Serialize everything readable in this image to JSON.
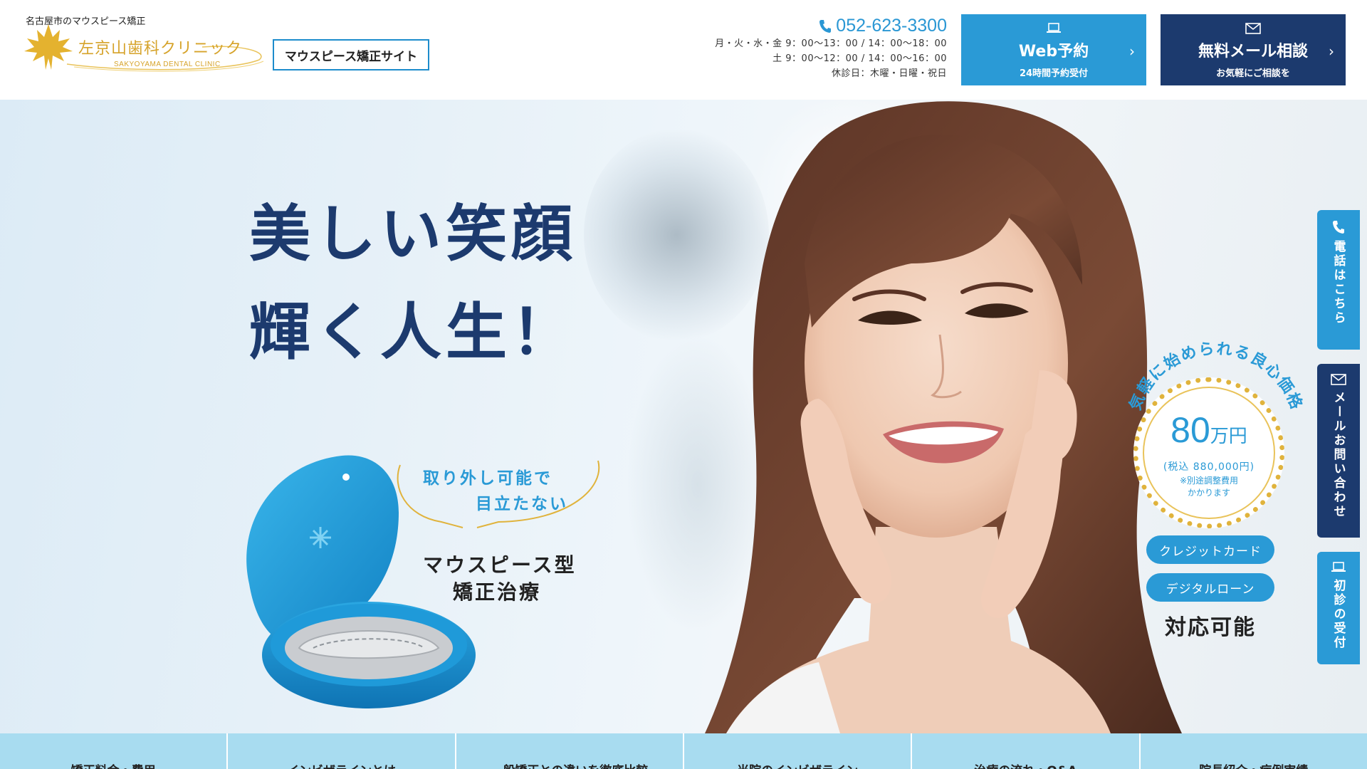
{
  "header": {
    "tagline": "名古屋市のマウスピース矯正",
    "logo_name": "左京山歯科クリニック",
    "logo_sub": "SAKYOYAMA DENTAL CLINIC",
    "site_badge": "マウスピース矯正サイト",
    "phone": "052-623-3300",
    "hours_1": "月・火・水・金 9：00〜13：00 / 14：00〜18：00",
    "hours_2": "土 9：00〜12：00 / 14：00〜16：00",
    "hours_3": "休診日：木曜・日曜・祝日",
    "web_btn_main": "Web予約",
    "web_btn_sub": "24時間予約受付",
    "mail_btn_main": "無料メール相談",
    "mail_btn_sub": "お気軽にご相談を",
    "arrow": "›"
  },
  "hero": {
    "headline_1": "美しい笑顔",
    "headline_2": "輝く人生！",
    "bubble_1": "取り外し可能で",
    "bubble_2": "目立たない",
    "treatment_1": "マウスピース型",
    "treatment_2": "矯正治療",
    "arc_text": "気軽に始められる良心価格",
    "price_num": "80",
    "price_unit": "万円",
    "price_tax": "(税込 880,000円)",
    "price_note_1": "※別途調整費用",
    "price_note_2": "かかります",
    "pay_1": "クレジットカード",
    "pay_2": "デジタルローン",
    "pay_ok": "対応可能"
  },
  "side": {
    "phone": "電話はこちら",
    "mail": "メールお問い合わせ",
    "first": "初診の受付"
  },
  "nav": [
    "矯正料金・費用",
    "インビザラインとは",
    "一般矯正との違いを徹底比較",
    "当院のインビザライン",
    "治療の流れ・Q&A",
    "院長紹介・症例実績"
  ],
  "colors": {
    "accent": "#2a9ad6",
    "navy": "#1c3a6e",
    "gold": "#d6a32a",
    "nav_bg": "#a8dcf0"
  }
}
